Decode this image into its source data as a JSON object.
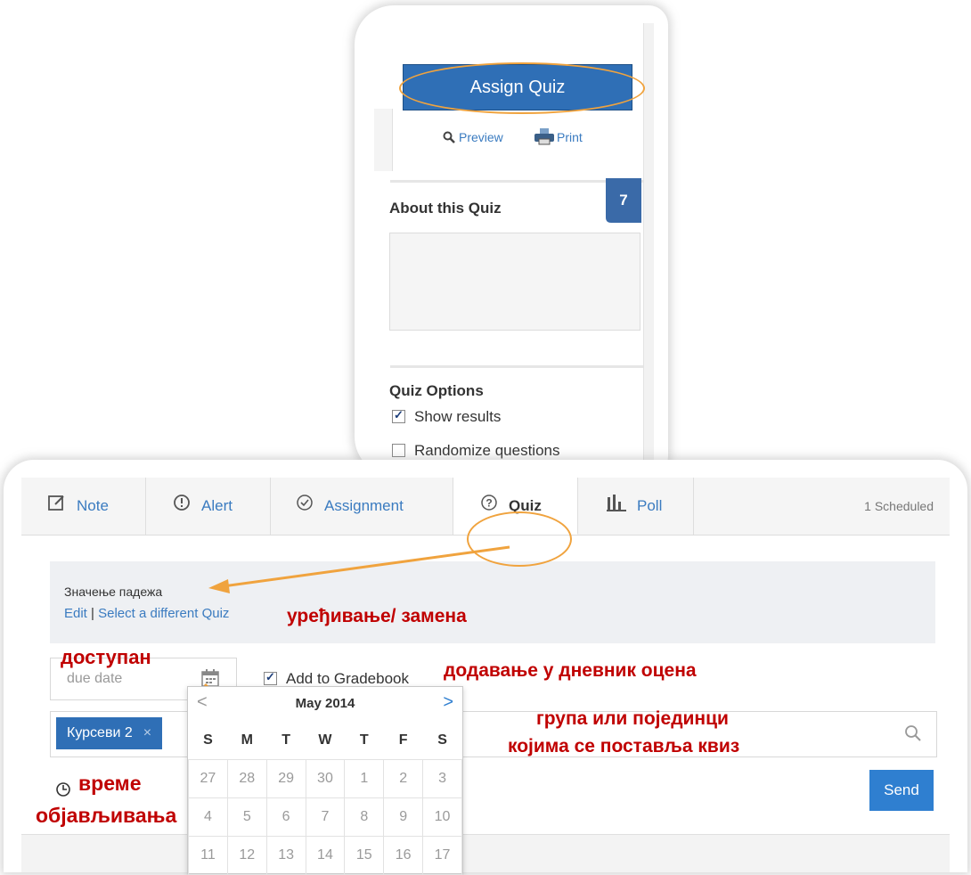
{
  "top_panel": {
    "assign_label": "Assign Quiz",
    "preview_label": "Preview",
    "print_label": "Print",
    "about_title": "About this Quiz",
    "badge_number": "7",
    "options_title": "Quiz Options",
    "option_show_results": "Show results",
    "option_randomize": "Randomize questions"
  },
  "tabs": [
    {
      "label": "Note"
    },
    {
      "label": "Alert"
    },
    {
      "label": "Assignment"
    },
    {
      "label": "Quiz"
    },
    {
      "label": "Poll"
    }
  ],
  "scheduled_label": "1 Scheduled",
  "quiz": {
    "name": "Значење падежа",
    "edit_label": "Edit",
    "separator": "|",
    "select_different_label": "Select a different Quiz"
  },
  "due_date_placeholder": "due date",
  "gradebook_label": "Add to Gradebook",
  "recipient_chip": "Курсеви 2",
  "chip_remove": "×",
  "send_label": "Send",
  "calendar": {
    "prev": "<",
    "next": ">",
    "month_label": "May 2014",
    "weekdays": [
      "S",
      "M",
      "T",
      "W",
      "T",
      "F",
      "S"
    ],
    "rows": [
      [
        "27",
        "28",
        "29",
        "30",
        "1",
        "2",
        "3"
      ],
      [
        "4",
        "5",
        "6",
        "7",
        "8",
        "9",
        "10"
      ],
      [
        "11",
        "12",
        "13",
        "14",
        "15",
        "16",
        "17"
      ]
    ]
  },
  "annotations": {
    "edit_replace": "уређивање/ замена",
    "available": "доступан",
    "gradebook": "додавање у дневник оцена",
    "group_line1": "група или појединци",
    "group_line2": "којима се поставља квиз",
    "time_line1": "време",
    "time_line2": "објављивања"
  },
  "colors": {
    "accent_blue": "#2f6fb6",
    "annotation_red": "#c00000",
    "highlight_orange": "#f0a33e"
  }
}
